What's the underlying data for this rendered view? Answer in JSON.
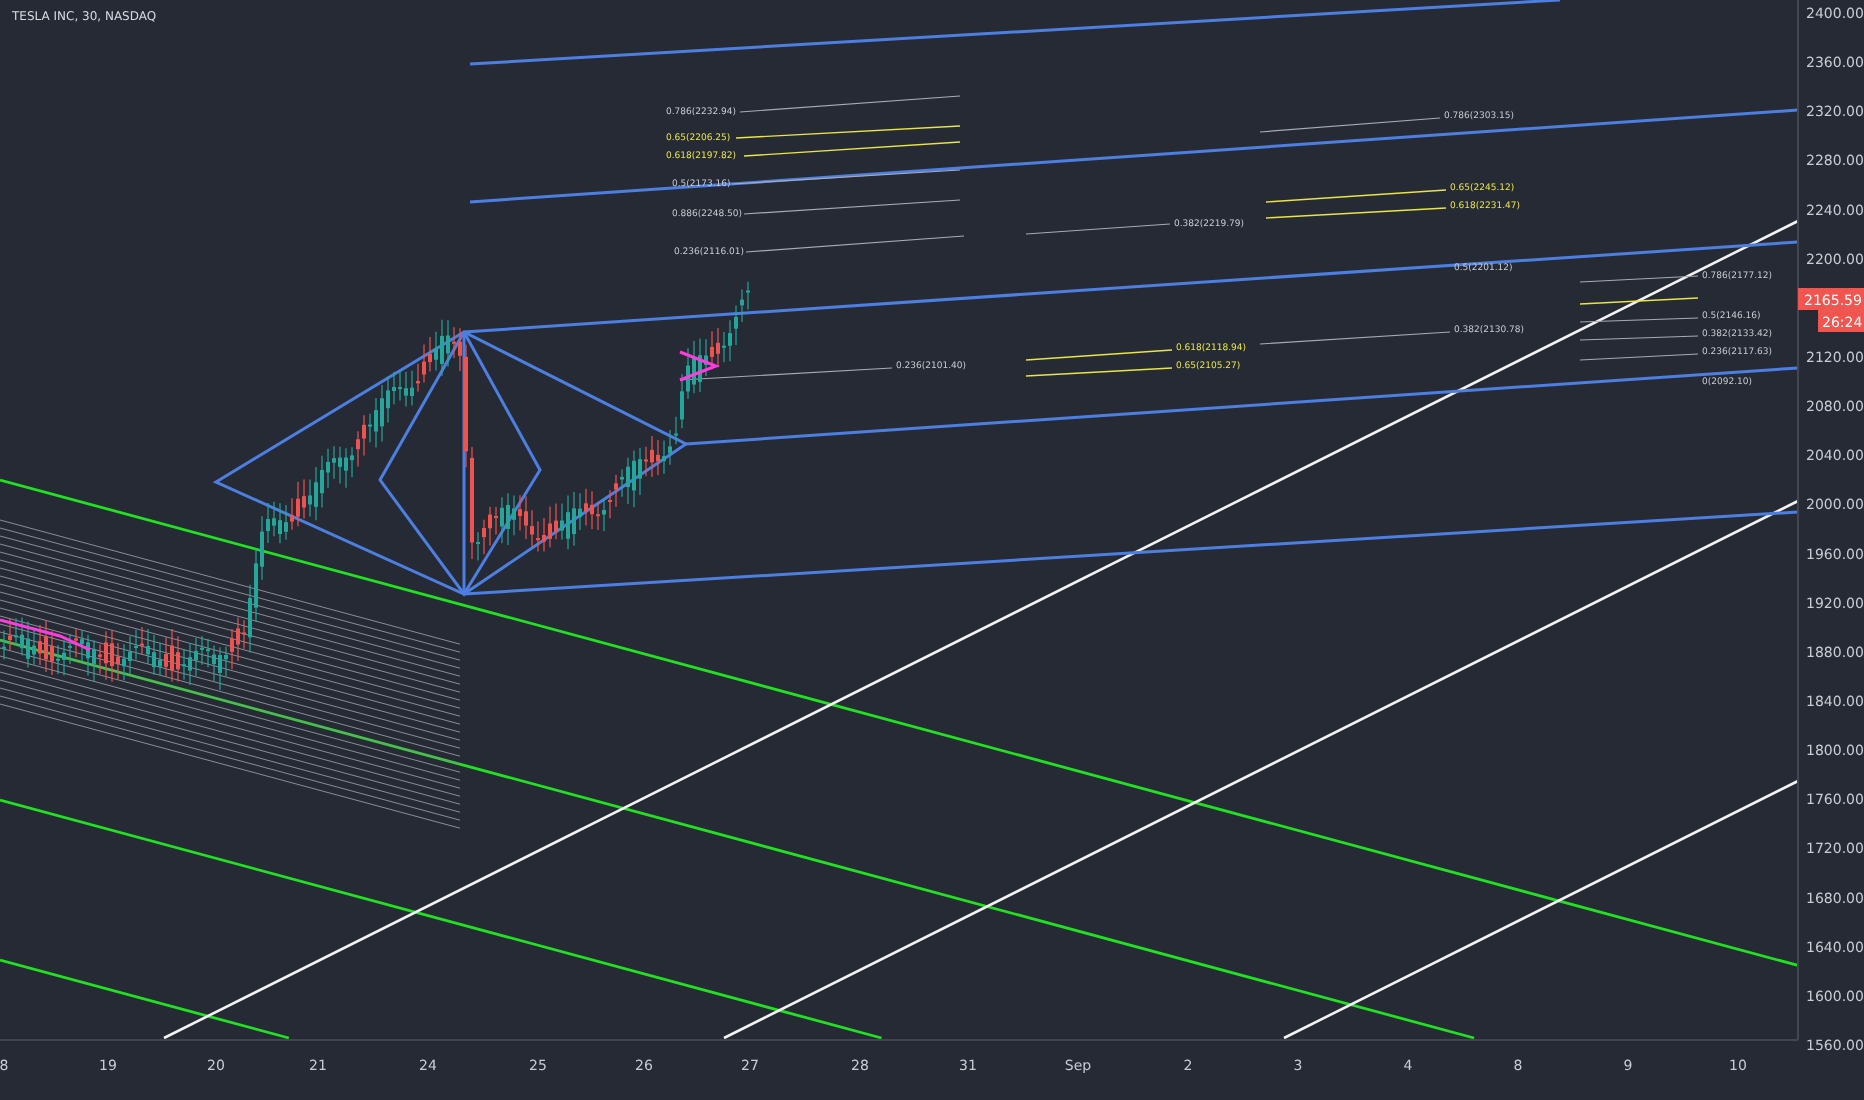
{
  "title": "TESLA INC, 30, NASDAQ",
  "y_axis_labels": [
    "2400.00",
    "2360.00",
    "2320.00",
    "2280.00",
    "2240.00",
    "2200.00",
    "2120.00",
    "2080.00",
    "2040.00",
    "2000.00",
    "1960.00",
    "1920.00",
    "1880.00",
    "1840.00",
    "1800.00",
    "1760.00",
    "1720.00",
    "1680.00",
    "1640.00",
    "1600.00",
    "1560.00"
  ],
  "x_axis_labels": [
    "8",
    "19",
    "20",
    "21",
    "24",
    "25",
    "26",
    "27",
    "28",
    "31",
    "Sep",
    "2",
    "3",
    "4",
    "8",
    "9",
    "10"
  ],
  "price_badges": [
    {
      "text": "2165.59",
      "kind": "price"
    },
    {
      "text": "26:24",
      "kind": "countdown"
    }
  ],
  "fib_labels": [
    {
      "text": "0.786(2232.94)",
      "kind": "gray"
    },
    {
      "text": "0.65(2206.25)",
      "kind": "yellow"
    },
    {
      "text": "0.618(2197.82)",
      "kind": "yellow"
    },
    {
      "text": "0.5(2173.16)",
      "kind": "gray"
    },
    {
      "text": "0.886(2248.50)",
      "kind": "gray"
    },
    {
      "text": "0.236(2116.01)",
      "kind": "gray"
    },
    {
      "text": "0.236(2101.40)",
      "kind": "gray"
    },
    {
      "text": "0.382(2219.79)",
      "kind": "gray"
    },
    {
      "text": "0.618(2118.94)",
      "kind": "yellow"
    },
    {
      "text": "0.65(2105.27)",
      "kind": "yellow"
    },
    {
      "text": "0.786(2303.15)",
      "kind": "gray"
    },
    {
      "text": "0.65(2245.12)",
      "kind": "yellow"
    },
    {
      "text": "0.618(2231.47)",
      "kind": "yellow"
    },
    {
      "text": "0.5(2201.12)",
      "kind": "gray"
    },
    {
      "text": "0.382(2130.78)",
      "kind": "gray"
    },
    {
      "text": "0.786(2177.12)",
      "kind": "gray"
    },
    {
      "text": "0.5(2146.16)",
      "kind": "gray"
    },
    {
      "text": "0.382(2133.42)",
      "kind": "gray"
    },
    {
      "text": "0.236(2117.63)",
      "kind": "gray"
    },
    {
      "text": "0(2092.10)",
      "kind": "gray"
    }
  ]
}
